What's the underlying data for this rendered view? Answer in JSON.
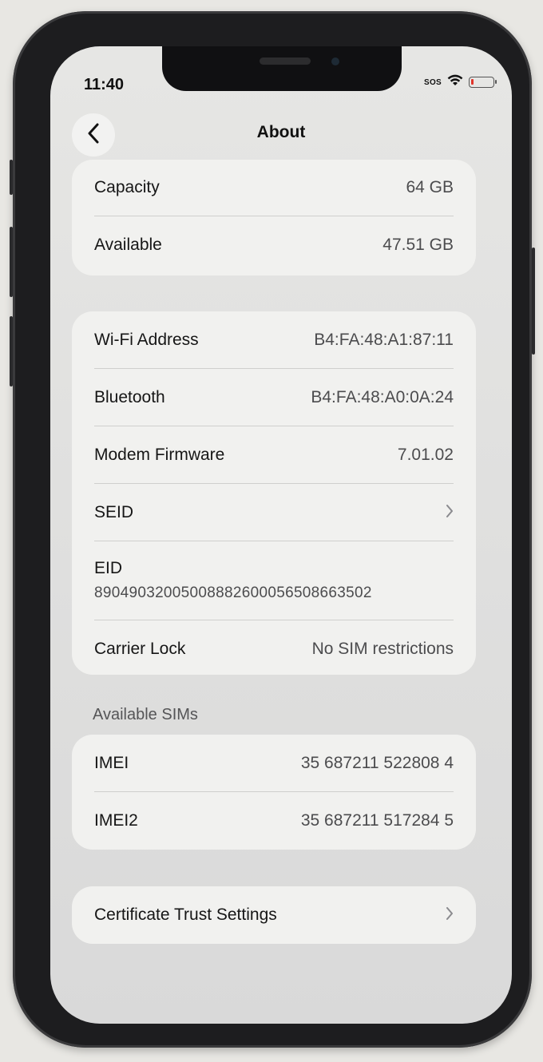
{
  "status": {
    "time": "11:40",
    "sos": "SOS"
  },
  "nav": {
    "title": "About",
    "back_icon": "chevron-left-icon"
  },
  "storage": [
    {
      "label": "Capacity",
      "value": "64 GB"
    },
    {
      "label": "Available",
      "value": "47.51 GB"
    }
  ],
  "network": {
    "wifi": {
      "label": "Wi-Fi Address",
      "value": "B4:FA:48:A1:87:11"
    },
    "bluetooth": {
      "label": "Bluetooth",
      "value": "B4:FA:48:A0:0A:24"
    },
    "modem": {
      "label": "Modem Firmware",
      "value": "7.01.02"
    },
    "seid": {
      "label": "SEID"
    },
    "eid": {
      "label": "EID",
      "value": "89049032005008882600056508663502"
    },
    "carrier": {
      "label": "Carrier Lock",
      "value": "No SIM restrictions"
    }
  },
  "sims": {
    "header": "Available SIMs",
    "imei": {
      "label": "IMEI",
      "value": "35 687211 522808 4"
    },
    "imei2": {
      "label": "IMEI2",
      "value": "35 687211 517284 5"
    }
  },
  "cert": {
    "label": "Certificate Trust Settings"
  },
  "colors": {
    "battery_low": "#e0352b",
    "group_bg": "#f1f1ef"
  }
}
